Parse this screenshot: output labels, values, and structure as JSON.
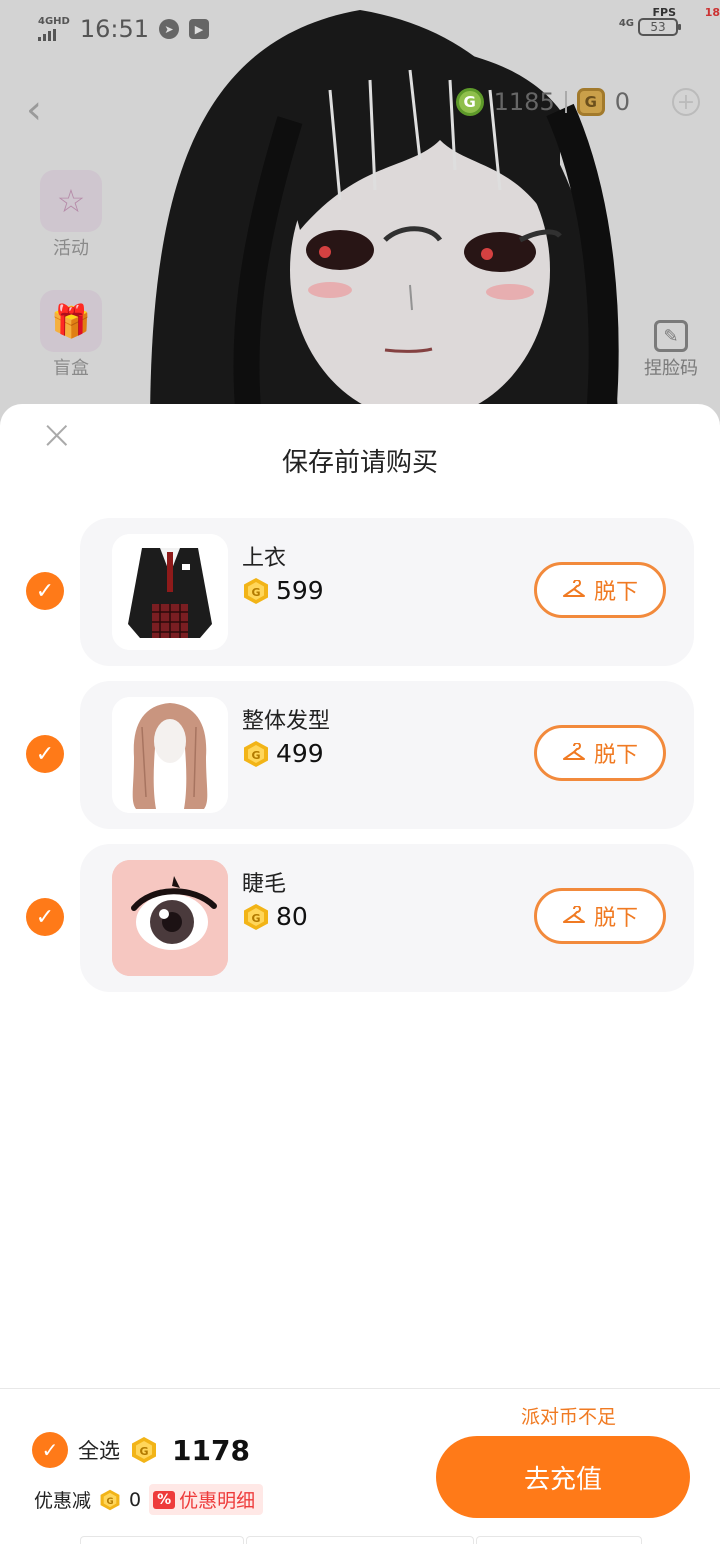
{
  "status_bar": {
    "network": "4GHD",
    "time": "16:51",
    "fps_label": "FPS",
    "fps_value": "18",
    "network_right": "4G",
    "battery": "53"
  },
  "wallet": {
    "green_coins": "1185",
    "bronze_coins": "0"
  },
  "side_menu": {
    "activity_label": "活动",
    "blindbox_label": "盲盒"
  },
  "face_code_label": "捏脸码",
  "sheet": {
    "title": "保存前请购买",
    "items": [
      {
        "name": "上衣",
        "price": "599",
        "button": "脱下"
      },
      {
        "name": "整体发型",
        "price": "499",
        "button": "脱下"
      },
      {
        "name": "睫毛",
        "price": "80",
        "button": "脱下"
      }
    ]
  },
  "footer": {
    "warning": "派对币不足",
    "select_all_label": "全选",
    "total": "1178",
    "discount_label": "优惠减",
    "discount_value": "0",
    "discount_tag_pct": "%",
    "discount_detail": "优惠明细",
    "recharge_button": "去充值"
  },
  "colors": {
    "accent": "#ff7a18",
    "card_bg": "#f6f6f8",
    "coin_gold": "#f2b417"
  }
}
